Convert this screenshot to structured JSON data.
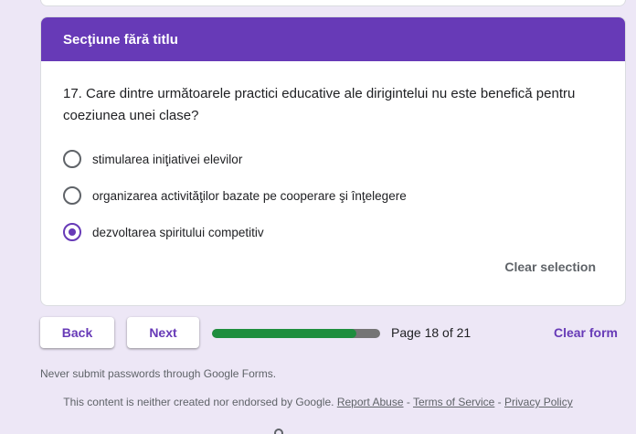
{
  "section": {
    "title": "Secţiune fără titlu",
    "header_color": "#673ab7"
  },
  "question": {
    "text": "17. Care dintre următoarele practici educative ale dirigintelui nu este benefică pentru coeziunea unei clase?",
    "options": [
      {
        "label": "stimularea iniţiativei elevilor",
        "selected": false
      },
      {
        "label": "organizarea activităţilor bazate pe cooperare şi înţelegere",
        "selected": false
      },
      {
        "label": "dezvoltarea spiritului competitiv",
        "selected": true
      }
    ],
    "clear_selection_label": "Clear selection"
  },
  "navigation": {
    "back_label": "Back",
    "next_label": "Next",
    "progress_fraction": 0.857,
    "page_indicator": "Page 18 of 21",
    "clear_form_label": "Clear form"
  },
  "footer": {
    "notice": "Never submit passwords through Google Forms.",
    "disclaimer": "This content is neither created nor endorsed by Google.",
    "report_abuse": "Report Abuse",
    "terms": "Terms of Service",
    "privacy": "Privacy Policy",
    "separator": " - "
  },
  "colors": {
    "accent": "#673ab7",
    "progress": "#1e8e3e",
    "background": "#ede7f6"
  }
}
